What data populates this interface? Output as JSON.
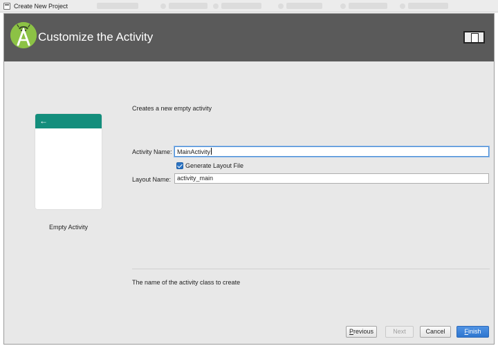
{
  "titlebar": {
    "title": "Create New Project"
  },
  "header": {
    "title": "Customize the Activity",
    "logo_icon": "android-studio-logo-icon",
    "device_icon": "device-frame-icon",
    "background": "#5a5a5a",
    "logo_color": "#8cc245"
  },
  "template": {
    "name": "Empty Activity",
    "bar_color": "#138e7c",
    "back_icon": "arrow-left-icon"
  },
  "form": {
    "description": "Creates a new empty activity",
    "activity_name_label": "Activity Name:",
    "activity_name_value": "MainActivity",
    "generate_layout_label": "Generate Layout File",
    "generate_layout_checked": true,
    "layout_name_label": "Layout Name:",
    "layout_name_value": "activity_main",
    "help_text": "The name of the activity class to create"
  },
  "buttons": {
    "previous_mnemonic": "P",
    "previous_rest": "revious",
    "next": "Next",
    "cancel": "Cancel",
    "finish_mnemonic": "F",
    "finish_rest": "inish"
  },
  "colors": {
    "primary_button": "#2f76cf",
    "focus_ring": "#4d8fd6",
    "checkbox": "#2b74c4"
  }
}
